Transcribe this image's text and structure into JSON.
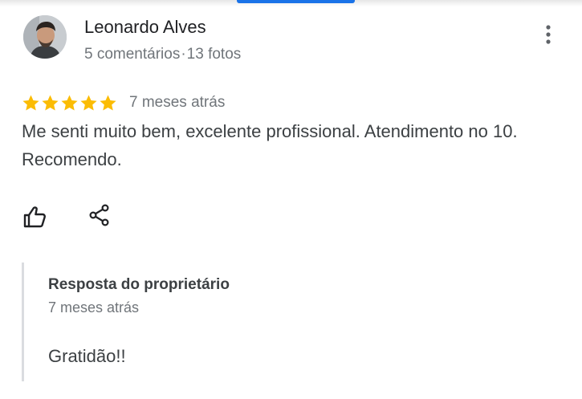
{
  "review": {
    "reviewer_name": "Leonardo Alves",
    "comments": "5 comentários",
    "separator": "·",
    "photos": "13 fotos",
    "rating": 5,
    "star_color": "#fbbc04",
    "date": "7 meses atrás",
    "text": "Me senti muito bem, excelente profissional. Atendimento no 10. Recomendo."
  },
  "owner_reply": {
    "title": "Resposta do proprietário",
    "date": "7 meses atrás",
    "text": "Gratidão!!"
  },
  "icons": {
    "avatar": "reviewer-photo",
    "more": "more-vert-icon",
    "like": "thumb-up-icon",
    "share": "share-icon"
  },
  "colors": {
    "accent": "#1a73e8"
  }
}
